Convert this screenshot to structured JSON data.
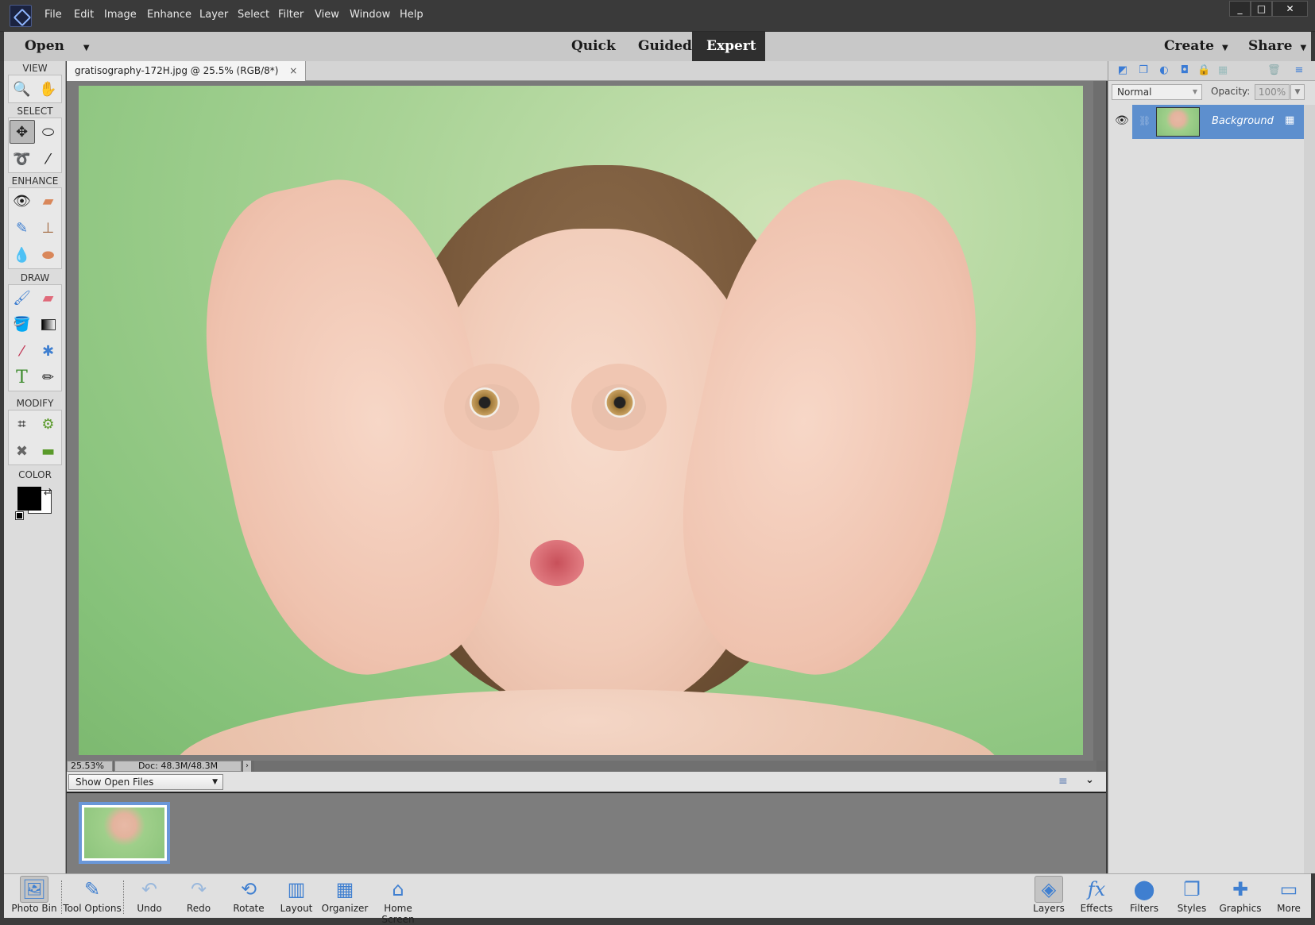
{
  "menu": [
    "File",
    "Edit",
    "Image",
    "Enhance",
    "Layer",
    "Select",
    "Filter",
    "View",
    "Window",
    "Help"
  ],
  "window_controls": {
    "minimize": "_",
    "maximize": "□",
    "close": "✕"
  },
  "modebar": {
    "open_label": "Open",
    "modes": [
      "Quick",
      "Guided",
      "Expert"
    ],
    "active_mode": "Expert",
    "create_label": "Create",
    "share_label": "Share"
  },
  "toolbox": {
    "sections": [
      {
        "label": "VIEW",
        "tools": [
          "zoom-icon",
          "hand-icon"
        ]
      },
      {
        "label": "SELECT",
        "tools": [
          "move-icon",
          "marquee-icon",
          "lasso-icon",
          "quick-selection-icon"
        ]
      },
      {
        "label": "ENHANCE",
        "tools": [
          "red-eye-icon",
          "spot-healing-icon",
          "smart-brush-icon",
          "clone-stamp-icon",
          "blur-icon",
          "sponge-icon"
        ]
      },
      {
        "label": "DRAW",
        "tools": [
          "brush-icon",
          "eraser-icon",
          "paint-bucket-icon",
          "gradient-icon",
          "eyedropper-icon",
          "custom-shape-icon",
          "type-icon",
          "pencil-icon"
        ]
      },
      {
        "label": "MODIFY",
        "tools": [
          "crop-icon",
          "recompose-icon",
          "content-aware-move-icon",
          "straighten-icon"
        ]
      },
      {
        "label": "COLOR",
        "tools": []
      }
    ],
    "foreground_color": "#000000",
    "background_color": "#ffffff"
  },
  "document": {
    "tab_title": "gratisography-172H.jpg @ 25.5% (RGB/8*)",
    "close_glyph": "×",
    "zoom_readout": "25.53%",
    "doc_size": "Doc: 48.3M/48.3M"
  },
  "bin": {
    "selector": "Show Open Files"
  },
  "layers_panel": {
    "blend_mode": "Normal",
    "opacity_label": "Opacity:",
    "opacity_value": "100%",
    "layers": [
      {
        "name": "Background",
        "visible": true
      }
    ]
  },
  "taskbar": {
    "left": [
      "Photo Bin",
      "Tool Options",
      "Undo",
      "Redo",
      "Rotate",
      "Layout",
      "Organizer",
      "Home Screen"
    ],
    "right": [
      "Layers",
      "Effects",
      "Filters",
      "Styles",
      "Graphics",
      "More"
    ]
  },
  "colors": {
    "accent": "#5d8fce",
    "titlebar": "#3a3a3a",
    "modebar": "#c8c8c8"
  }
}
